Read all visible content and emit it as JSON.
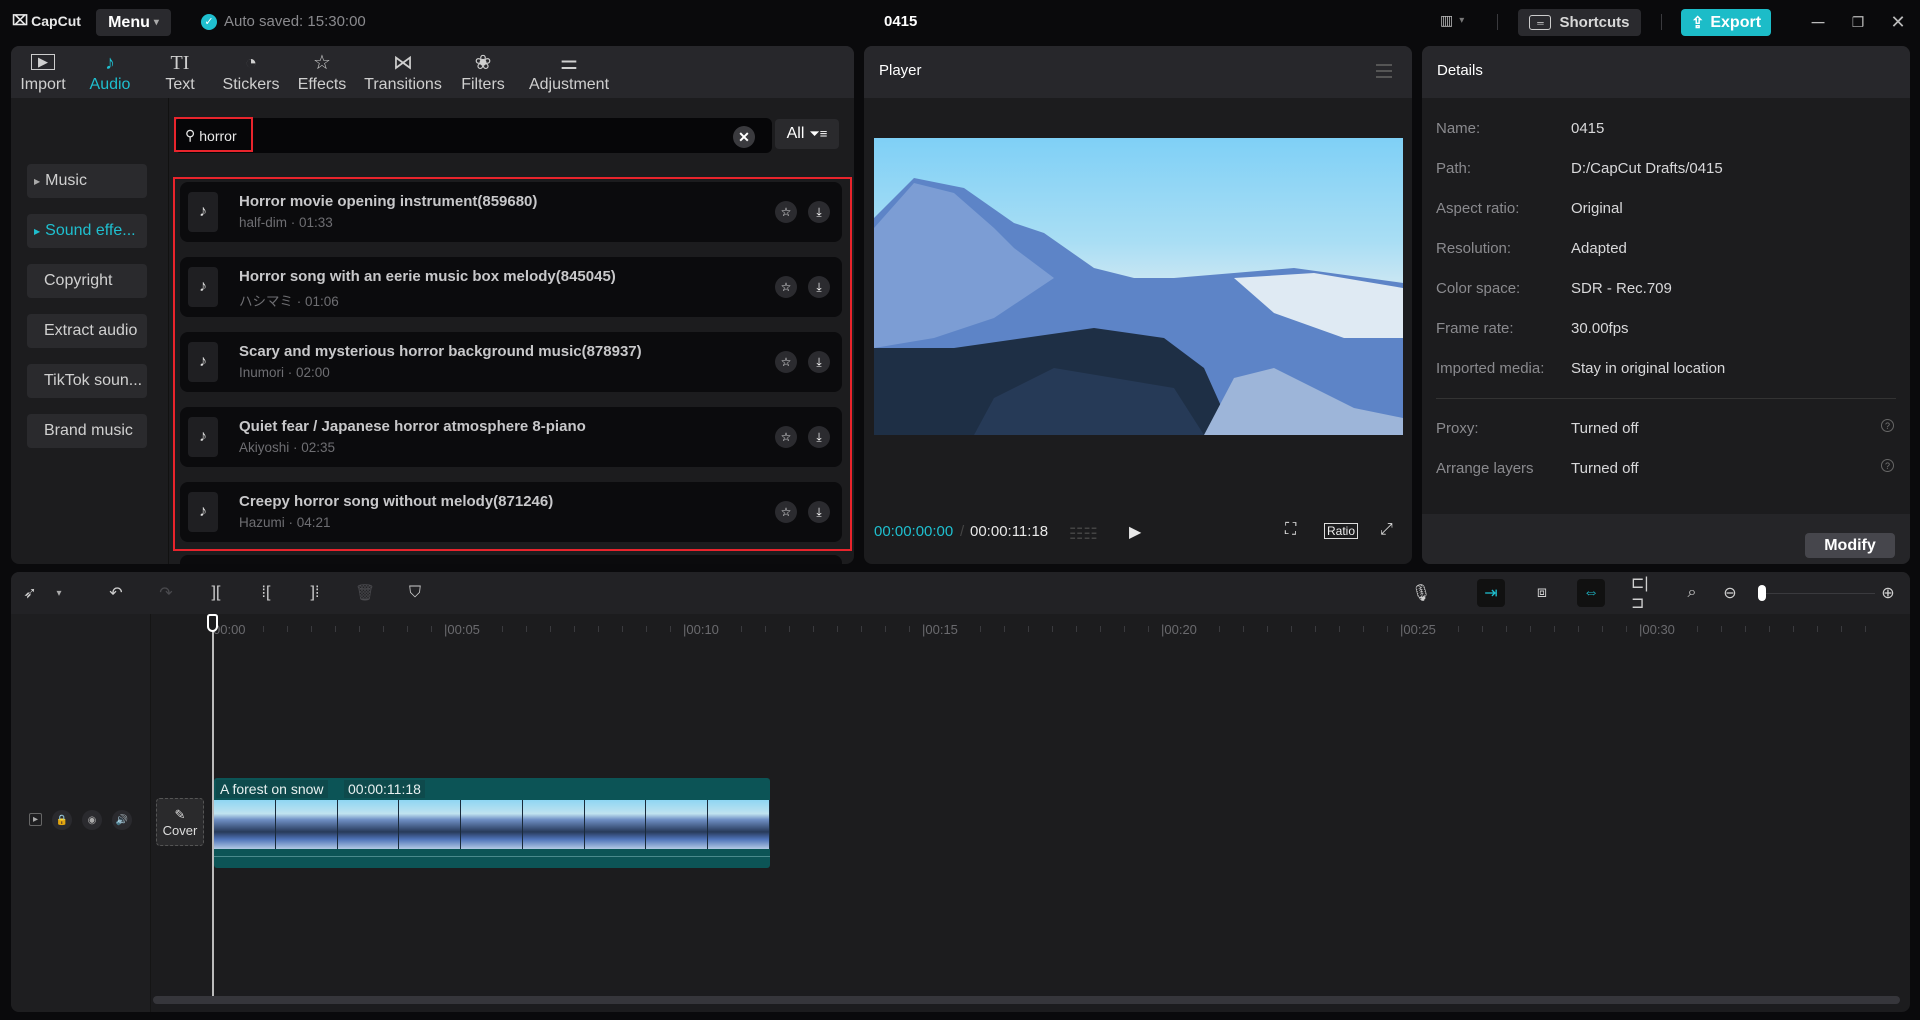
{
  "titlebar": {
    "app_name": "CapCut",
    "menu_label": "Menu",
    "autosave": "Auto saved: 15:30:00",
    "project_title": "0415",
    "shortcuts_label": "Shortcuts",
    "export_label": "Export",
    "accent_color": "#1fbfcf"
  },
  "media_tabs": [
    {
      "label": "Import",
      "icon": "import-icon",
      "glyph": "▶"
    },
    {
      "label": "Audio",
      "icon": "audio-icon",
      "glyph": "♪",
      "active": true
    },
    {
      "label": "Text",
      "icon": "text-icon",
      "glyph": "TI"
    },
    {
      "label": "Stickers",
      "icon": "sticker-icon",
      "glyph": "◔"
    },
    {
      "label": "Effects",
      "icon": "effects-icon",
      "glyph": "☆"
    },
    {
      "label": "Transitions",
      "icon": "transitions-icon",
      "glyph": "⋈"
    },
    {
      "label": "Filters",
      "icon": "filters-icon",
      "glyph": "❀"
    },
    {
      "label": "Adjustment",
      "icon": "adjustment-icon",
      "glyph": "⚌"
    }
  ],
  "categories": [
    {
      "label": "Music",
      "has_arrow": true
    },
    {
      "label": "Sound effe...",
      "has_arrow": true,
      "active": true
    },
    {
      "label": "Copyright"
    },
    {
      "label": "Extract audio"
    },
    {
      "label": "TikTok soun..."
    },
    {
      "label": "Brand music"
    }
  ],
  "search": {
    "value": "horror",
    "filter_label": "All"
  },
  "results": [
    {
      "title": "Horror movie opening instrument(859680)",
      "artist": "half-dim",
      "duration": "01:33",
      "subtitle": "half-dim · 01:33"
    },
    {
      "title": "Horror song with an eerie music box melody(845045)",
      "artist": "ハシマミ",
      "duration": "01:06",
      "subtitle": "ハシマミ · 01:06"
    },
    {
      "title": "Scary and mysterious horror background music(878937)",
      "artist": "Inumori",
      "duration": "02:00",
      "subtitle": "Inumori · 02:00"
    },
    {
      "title": "Quiet fear / Japanese horror atmosphere 8-piano",
      "artist": "Akiyoshi",
      "duration": "02:35",
      "subtitle": "Akiyoshi · 02:35"
    },
    {
      "title": "Creepy horror song without melody(871246)",
      "artist": "Hazumi",
      "duration": "04:21",
      "subtitle": "Hazumi · 04:21"
    }
  ],
  "player": {
    "title": "Player",
    "current_time": "00:00:00:00",
    "separator": "/",
    "total_time": "00:00:11:18",
    "ratio_label": "Ratio"
  },
  "details": {
    "title": "Details",
    "rows": [
      {
        "label": "Name:",
        "value": "0415"
      },
      {
        "label": "Path:",
        "value": "D:/CapCut Drafts/0415"
      },
      {
        "label": "Aspect ratio:",
        "value": "Original"
      },
      {
        "label": "Resolution:",
        "value": "Adapted"
      },
      {
        "label": "Color space:",
        "value": "SDR - Rec.709"
      },
      {
        "label": "Frame rate:",
        "value": "30.00fps"
      },
      {
        "label": "Imported media:",
        "value": "Stay in original location"
      }
    ],
    "extra_rows": [
      {
        "label": "Proxy:",
        "value": "Turned off"
      },
      {
        "label": "Arrange layers",
        "value": "Turned off"
      }
    ],
    "modify_label": "Modify"
  },
  "timeline": {
    "ruler_labels": [
      "00:00",
      "00:05",
      "00:10",
      "00:15",
      "00:20",
      "00:25",
      "00:30"
    ],
    "clip": {
      "name": "A forest on snow",
      "duration": "00:00:11:18"
    },
    "cover_label": "Cover",
    "zoom_level": 0.05
  }
}
